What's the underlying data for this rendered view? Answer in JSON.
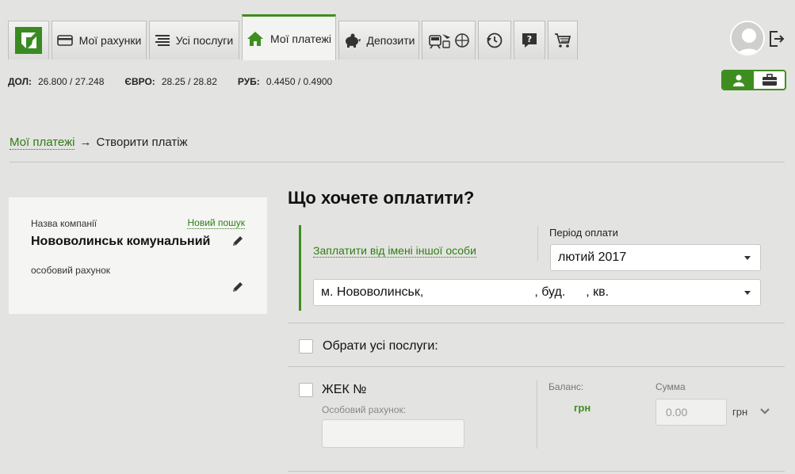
{
  "nav": {
    "tabs": [
      {
        "label": "",
        "icon": "privatbank-logo-icon"
      },
      {
        "label": "Мої рахунки",
        "icon": "card-icon"
      },
      {
        "label": "Усі послуги",
        "icon": "list-icon"
      },
      {
        "label": "Мої платежі",
        "icon": "home-icon",
        "active": true
      },
      {
        "label": "Депозити",
        "icon": "piggy-bank-icon"
      },
      {
        "label": "",
        "icon": "travel-icon"
      },
      {
        "label": "",
        "icon": "history-icon"
      },
      {
        "label": "",
        "icon": "help-icon"
      },
      {
        "label": "",
        "icon": "cart-icon"
      }
    ]
  },
  "rates": {
    "usd_label": "ДОЛ:",
    "usd_value": "26.800 / 27.248",
    "eur_label": "ЄВРО:",
    "eur_value": "28.25 / 28.82",
    "rub_label": "РУБ:",
    "rub_value": "0.4450 / 0.4900"
  },
  "breadcrumb": {
    "parent": "Мої платежі",
    "arrow": "→",
    "current": "Створити платіж"
  },
  "company_card": {
    "company_label": "Назва компанії",
    "new_search_link": "Новий пошук",
    "company_name": "Нововолинськ комунальний",
    "account_label": "особовий рахунок"
  },
  "form": {
    "title": "Що хочете оплатити?",
    "pay_other_link": "Заплатити від імені іншої особи",
    "period_label": "Період оплати",
    "period_value": "лютий 2017",
    "address_prefix": "м. Нововолинськ,",
    "address_house": ", буд.",
    "address_flat": ", кв.",
    "select_all_label": "Обрати усі послуги:",
    "service_name": "ЖЕК №",
    "service_account_label": "Особовий рахунок:",
    "balance_label": "Баланс:",
    "balance_value": "грн",
    "sum_label": "Сумма",
    "sum_placeholder": "0.00",
    "currency": "грн"
  },
  "colors": {
    "accent": "#3e8e1f",
    "link": "#2f7d14",
    "background": "#e3e3e1"
  }
}
